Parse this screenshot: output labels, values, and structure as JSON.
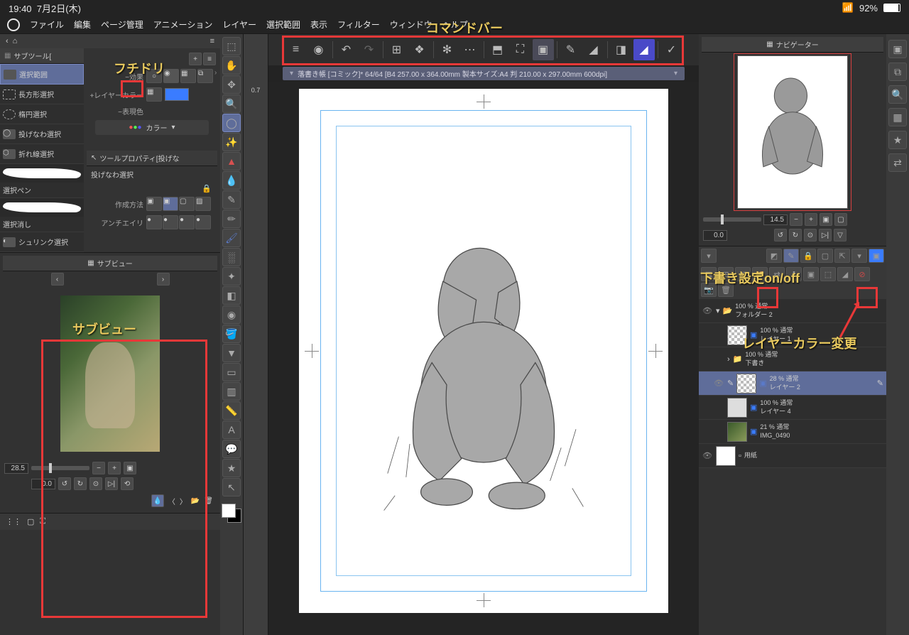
{
  "status": {
    "time": "19:40",
    "date": "7月2日(木)",
    "battery": "92%"
  },
  "menu": [
    "ファイル",
    "編集",
    "ページ管理",
    "アニメーション",
    "レイヤー",
    "選択範囲",
    "表示",
    "フィルター",
    "ウィンドウ",
    "ヘルプ"
  ],
  "subtool": {
    "header": "サブツール[",
    "items": [
      "選択範囲",
      "長方形選択",
      "楕円選択",
      "投げなわ選択",
      "折れ線選択",
      "選択ペン",
      "選択消し",
      "シュリンク選択"
    ],
    "active": 0
  },
  "properties": {
    "effect_label": "効果",
    "layer_color_label": "レイヤーカラー",
    "expression_label": "表現色",
    "color_value": "カラー",
    "tool_prop_header": "ツールプロパティ[投げな",
    "tool_name": "投げなわ選択",
    "method_label": "作成方法",
    "antialias_label": "アンチエイリ"
  },
  "subview": {
    "header": "サブビュー",
    "zoom": "28.5",
    "fit": "0.0"
  },
  "doc_title": "落書き帳 [コミック]* 64/64 [B4 257.00 x 364.00mm 製本サイズ:A4 判 210.00 x 297.00mm 600dpi]",
  "ruler_val": "0.7",
  "navigator": {
    "header": "ナビゲーター",
    "zoom": "14.5",
    "rotation": "0.0"
  },
  "layers": {
    "folder": {
      "opacity": "100 % 通常",
      "name": "フォルダー 2"
    },
    "items": [
      {
        "opacity": "100 % 通常",
        "name": "レイヤー 1",
        "thumb": "checker"
      },
      {
        "opacity": "100 % 通常",
        "name": "下書き",
        "folder": true
      },
      {
        "opacity": "28 % 通常",
        "name": "レイヤー 2",
        "thumb": "checker",
        "selected": true
      },
      {
        "opacity": "100 % 通常",
        "name": "レイヤー 4",
        "thumb": "sketch"
      },
      {
        "opacity": "21 % 通常",
        "name": "IMG_0490",
        "thumb": "photo"
      },
      {
        "opacity": "",
        "name": "用紙",
        "thumb": "white"
      }
    ]
  },
  "annotations": {
    "command_bar": "コマンドバー",
    "border": "フチドリ",
    "subview": "サブビュー",
    "draft": "下書き設定on/off",
    "layer_color": "レイヤーカラー変更"
  }
}
